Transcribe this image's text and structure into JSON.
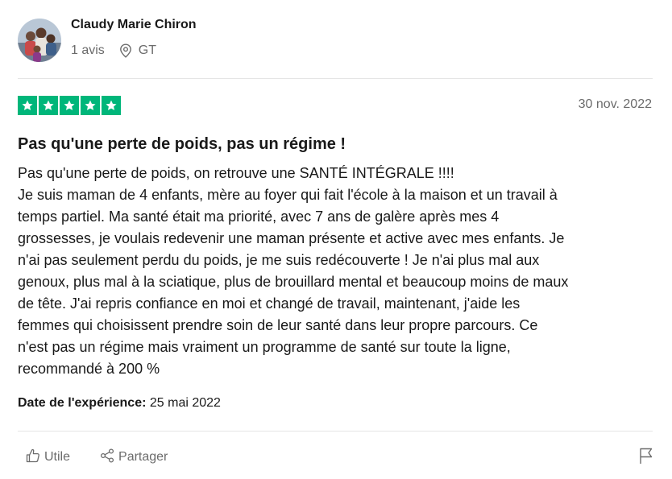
{
  "consumer": {
    "name": "Claudy Marie Chiron",
    "review_count": "1 avis",
    "country": "GT"
  },
  "review": {
    "rating_stars": 5,
    "date": "30 nov. 2022",
    "title": "Pas qu'une perte de poids, pas un régime !",
    "body_lines": [
      "Pas qu'une perte de poids, on retrouve une SANTÉ INTÉGRALE !!!!",
      "Je suis maman de 4 enfants, mère au foyer qui fait l'école à la maison et un travail à",
      "temps partiel. Ma santé était ma priorité, avec 7 ans de galère après mes 4",
      "grossesses, je voulais redevenir une maman présente et active avec mes enfants. Je",
      "n'ai pas seulement perdu du poids, je me suis redécouverte ! Je n'ai plus mal aux",
      "genoux, plus mal à la sciatique, plus de brouillard mental et beaucoup moins de maux",
      "de tête. J'ai repris confiance en moi et changé de travail, maintenant, j'aide les",
      "femmes qui choisissent prendre soin de leur santé dans leur propre parcours. Ce",
      "n'est pas un régime mais vraiment un programme de santé sur toute la ligne,",
      "recommandé à 200 %"
    ],
    "experience_label": "Date de l'expérience:",
    "experience_date": "25 mai 2022"
  },
  "actions": {
    "useful_label": "Utile",
    "share_label": "Partager"
  },
  "colors": {
    "star_green": "#00b67a",
    "muted_text": "#6b6b6b"
  },
  "icons": {
    "location": "map-pin-icon",
    "useful": "thumbs-up-icon",
    "share": "share-icon",
    "report": "flag-icon"
  }
}
